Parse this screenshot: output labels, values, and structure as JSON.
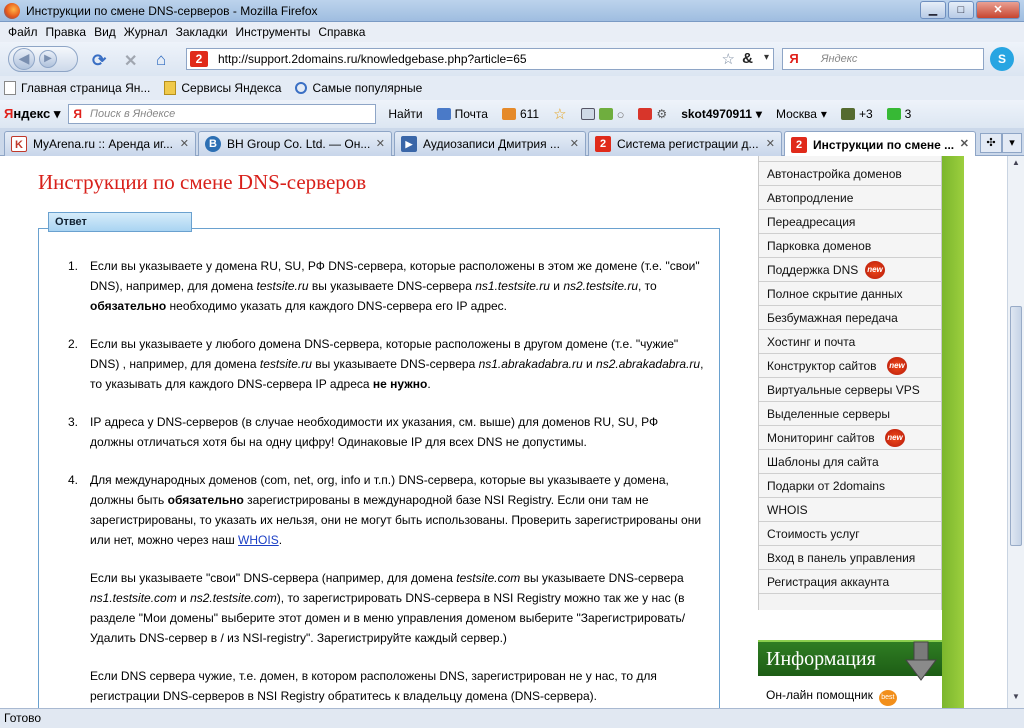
{
  "window": {
    "title": "Инструкции по смене DNS-серверов - Mozilla Firefox"
  },
  "menu": [
    "Файл",
    "Правка",
    "Вид",
    "Журнал",
    "Закладки",
    "Инструменты",
    "Справка"
  ],
  "nav": {
    "url": "http://support.2domains.ru/knowledgebase.php?article=65",
    "search_placeholder": "Яндекс"
  },
  "bookmarks": [
    "Главная страница Ян...",
    "Сервисы Яндекса",
    "Самые популярные"
  ],
  "yabar": {
    "logo_left": "Я",
    "logo_right": "ндекс",
    "search_placeholder": "Поиск в Яндексе",
    "find": "Найти",
    "mail": "Почта",
    "count": "611",
    "user": "skot4970911",
    "city": "Москва",
    "plus": "+3",
    "num": "3"
  },
  "tabs": [
    {
      "label": "MyArena.ru :: Аренда иг...",
      "color": "#c0392b",
      "glyph": "K"
    },
    {
      "label": "BH Group Co. Ltd. — Он...",
      "color": "#2c6fb3",
      "glyph": "B"
    },
    {
      "label": "Аудиозаписи Дмитрия ...",
      "color": "#3a66a8",
      "glyph": "▶"
    },
    {
      "label": "Система регистрации д...",
      "color": "#e02a1a",
      "glyph": "2"
    },
    {
      "label": "Инструкции по смене ...",
      "color": "#e02a1a",
      "glyph": "2"
    }
  ],
  "page": {
    "title": "Инструкции по смене DNS-серверов",
    "answer_label": "Ответ",
    "items": [
      {
        "num": "1.",
        "p1": "Если вы указываете у домена RU, SU, РФ DNS-сервера, которые расположены в этом же домене (т.е. \"свои\" DNS), например, для домена ",
        "i1": "testsite.ru",
        "p2": " вы указываете DNS-сервера ",
        "i2": "ns1.testsite.ru",
        "p3": " и ",
        "i3": "ns2.testsite.ru",
        "p4": ", то ",
        "b1": "обязательно",
        "p5": " необходимо указать для каждого DNS-сервера его IP адрес."
      },
      {
        "num": "2.",
        "p1": "Если вы указываете у любого домена DNS-сервера, которые расположены в другом домене (т.е. \"чужие\" DNS) , например, для домена ",
        "i1": "testsite.ru",
        "p2": " вы указываете DNS-сервера ",
        "i2": "ns1.abrakadabra.ru",
        "p3": " и ",
        "i3": "ns2.abrakadabra.ru",
        "p4": ", то указывать для каждого DNS-сервера IP адреса ",
        "b1": "не нужно",
        "p5": "."
      },
      {
        "num": "3.",
        "text": "IP адреса у DNS-серверов (в случае необходимости их указания, см. выше) для доменов RU, SU, РФ должны отличаться хотя бы на одну цифру! Одинаковые IP для всех DNS не допустимы."
      },
      {
        "num": "4.",
        "p1": "Для международных доменов (com, net, org, info и т.п.) DNS-сервера, которые вы указываете у домена, должны быть ",
        "b1": "обязательно",
        "p2": " зарегистрированы в международной базе NSI Registry. Если они там не зарегистрированы, то указать их нельзя, они не могут быть использованы. Проверить зарегистрированы они или нет, можно через наш ",
        "link": "WHOIS",
        "p3": "."
      }
    ],
    "para2": {
      "p1": "Если вы указываете \"свои\" DNS-сервера (например, для домена ",
      "i1": "testsite.com",
      "p2": " вы указываете DNS-сервера ",
      "i2": "ns1.testsite.com",
      "p3": " и ",
      "i3": "ns2.testsite.com",
      "p4": "), то зарегистрировать DNS-сервера в NSI Registry можно так же у нас (в разделе \"Мои домены\" выберите этот домен и в меню управления доменом выберите \"Зарегистрировать/Удалить DNS-сервер в / из NSI-registry\". Зарегистрируйте каждый сервер.)"
    },
    "para3": "Если DNS сервера чужие, т.е. домен, в котором расположены DNS, зарегистрирован не у нас, то для регистрации DNS-серверов в NSI Registry обратитесь к владельцу домена (DNS-сервера)."
  },
  "sidebar": {
    "items": [
      {
        "label": "Автонастройка доменов"
      },
      {
        "label": "Автопродление"
      },
      {
        "label": "Переадресация"
      },
      {
        "label": "Парковка доменов"
      },
      {
        "label": "Поддержка DNS",
        "badge": "new"
      },
      {
        "label": "Полное скрытие данных"
      },
      {
        "label": "Безбумажная передача"
      },
      {
        "label": "Хостинг и почта"
      },
      {
        "label": "Конструктор сайтов",
        "badge": "new"
      },
      {
        "label": "Виртуальные серверы VPS"
      },
      {
        "label": "Выделенные серверы"
      },
      {
        "label": "Мониторинг сайтов",
        "badge": "new"
      },
      {
        "label": "Шаблоны для сайта"
      },
      {
        "label": "Подарки от 2domains"
      },
      {
        "label": "WHOIS"
      },
      {
        "label": "Стоимость услуг"
      },
      {
        "label": "Вход в панель управления"
      },
      {
        "label": "Регистрация аккаунта"
      }
    ],
    "info_title": "Информация",
    "info_item": "Он-лайн помощник",
    "best_badge": "best"
  },
  "status": "Готово"
}
